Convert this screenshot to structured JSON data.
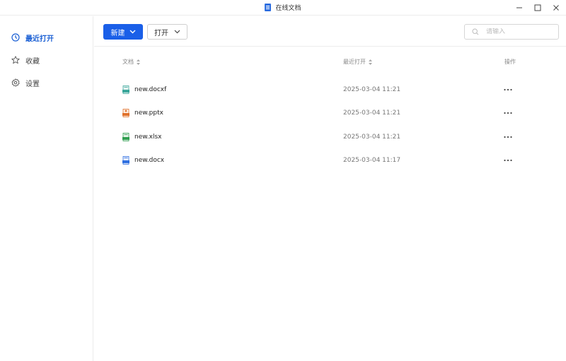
{
  "window": {
    "title": "在线文档"
  },
  "sidebar": {
    "items": [
      {
        "label": "最近打开",
        "icon": "clock-icon",
        "active": true
      },
      {
        "label": "收藏",
        "icon": "star-icon",
        "active": false
      },
      {
        "label": "设置",
        "icon": "gear-icon",
        "active": false
      }
    ]
  },
  "toolbar": {
    "new_label": "新建",
    "open_label": "打开",
    "search_placeholder": "请输入"
  },
  "table": {
    "headers": {
      "name": "文档",
      "time": "最近打开",
      "ops": "操作"
    },
    "rows": [
      {
        "name": "new.docxf",
        "time": "2025-03-04 11:21",
        "type": "docxf",
        "icon_color": "#3aa69a"
      },
      {
        "name": "new.pptx",
        "time": "2025-03-04 11:21",
        "type": "pptx",
        "icon_color": "#e0712c"
      },
      {
        "name": "new.xlsx",
        "time": "2025-03-04 11:21",
        "type": "xlsx",
        "icon_color": "#2e9e4f"
      },
      {
        "name": "new.docx",
        "time": "2025-03-04 11:17",
        "type": "docx",
        "icon_color": "#2f6fe0"
      }
    ]
  },
  "colors": {
    "accent": "#1a5fe8",
    "active_text": "#1a5fd4"
  }
}
